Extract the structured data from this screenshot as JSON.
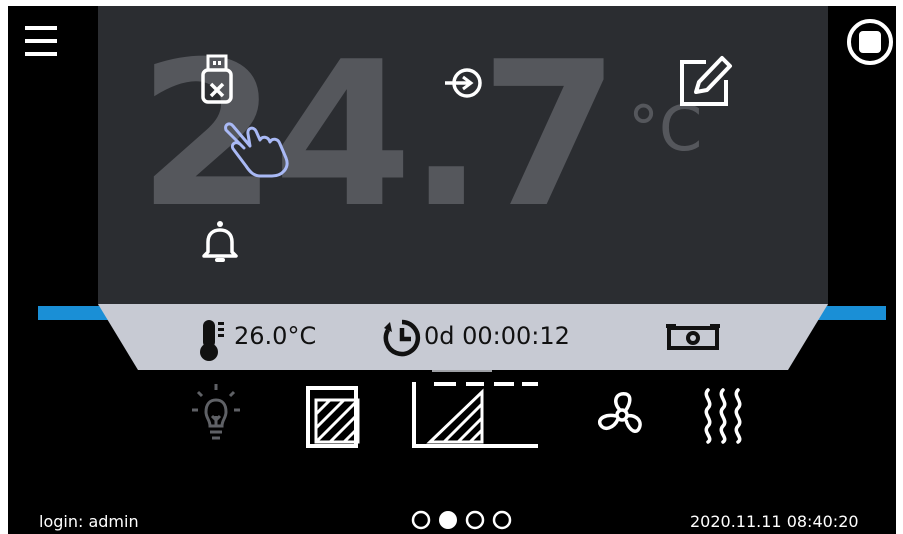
{
  "main": {
    "temperature": "24.7",
    "unit": "°C"
  },
  "info": {
    "setpoint": "26.0°C",
    "timer": "0d 00:00:12"
  },
  "footer": {
    "login": "login: admin",
    "datetime": "2020.11.11  08:40:20",
    "page_indicator": {
      "pages": 4,
      "current": 2
    }
  },
  "icons": {
    "menu": "menu-icon",
    "stop": "stop-icon",
    "usb": "usb-disconnected-icon",
    "key": "key-icon",
    "edit": "edit-icon",
    "touch": "hand-pointer-icon",
    "alarm": "bell-icon",
    "thermometer": "thermometer-icon",
    "clock": "clock-icon",
    "camera": "camera-icon",
    "bulb": "light-bulb-icon",
    "segment1": "program-segment-icon",
    "segment2": "program-ramp-icon",
    "fan": "fan-icon",
    "heating": "heating-icon"
  },
  "colors": {
    "background": "#000000",
    "panel": "#2b2d31",
    "accent": "#1a8fd6",
    "info_bar": "#c7cad3",
    "big_text": "#55575c"
  }
}
